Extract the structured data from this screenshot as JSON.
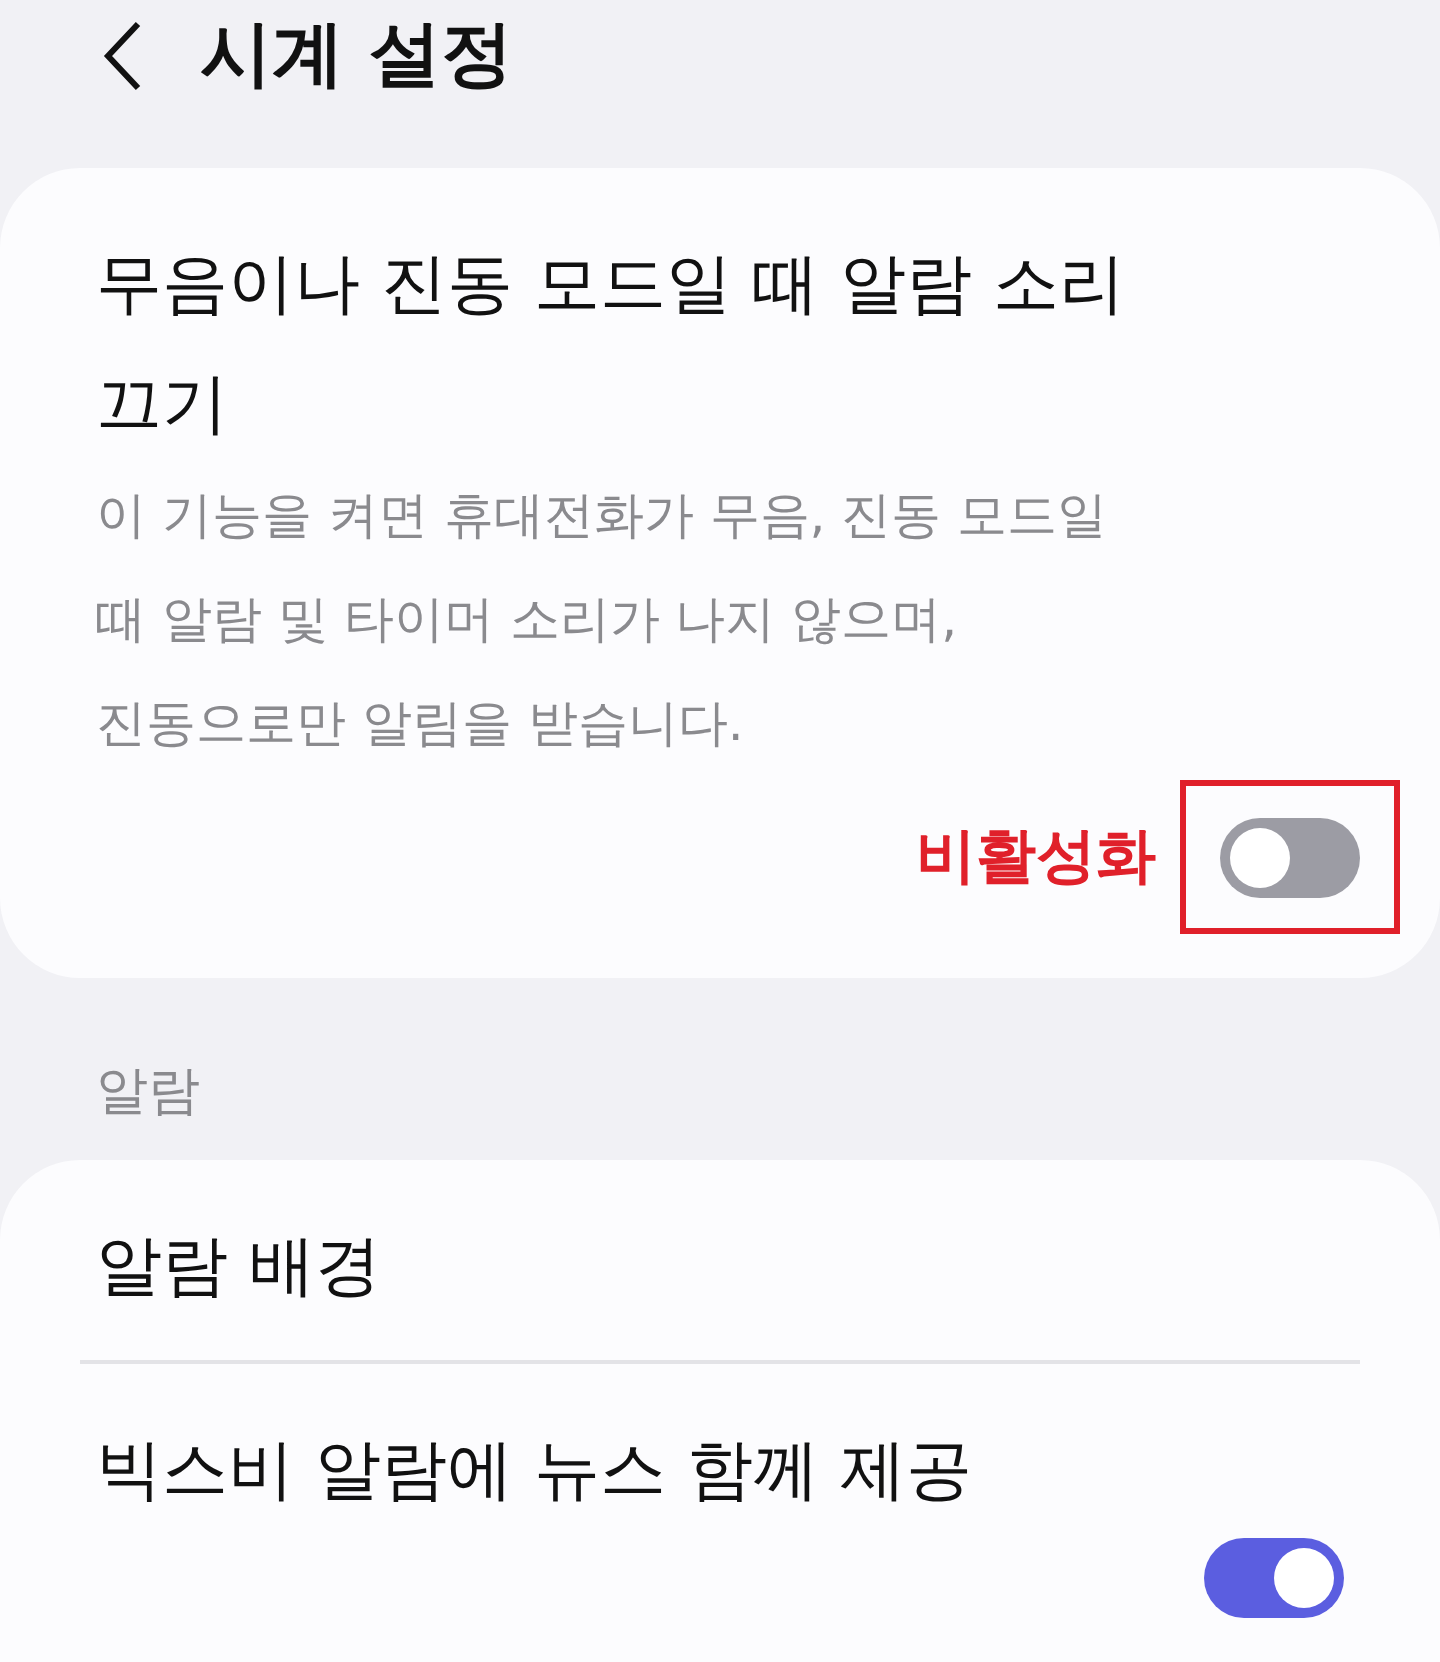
{
  "header": {
    "title": "시계 설정"
  },
  "silent_setting": {
    "title": "무음이나 진동 모드일 때 알람 소리 끄기",
    "description": "이 기능을 켜면 휴대전화가 무음, 진동 모드일 때 알람 및 타이머 소리가 나지 않으며, 진동으로만 알림을 받습니다.",
    "on": false,
    "annotation": "비활성화"
  },
  "alarm_section": {
    "label": "알람",
    "items": [
      {
        "kind": "link",
        "title": "알람 배경"
      },
      {
        "kind": "toggle",
        "title": "빅스비 알람에 뉴스 함께 제공",
        "on": true
      }
    ]
  }
}
